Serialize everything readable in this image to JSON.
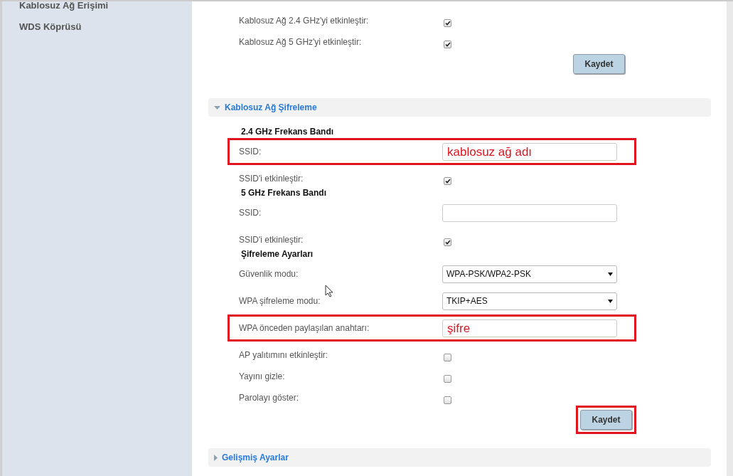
{
  "sidebar": {
    "items": [
      {
        "label": "Kablosuz Ağ Erişimi"
      },
      {
        "label": "WDS Köprüsü"
      }
    ]
  },
  "top_section": {
    "items": [
      {
        "kind": "checkbox",
        "label": "Kablosuz Ağ 2.4 GHz'yi etkinleştir:",
        "checked": true
      },
      {
        "kind": "checkbox",
        "label": "Kablosuz Ağ 5 GHz'yi etkinleştir:",
        "checked": true
      }
    ],
    "save_button": {
      "label": "Kaydet"
    }
  },
  "sections": [
    {
      "title": "Kablosuz Ağ Şifreleme",
      "expanded": true,
      "items": [
        {
          "kind": "heading",
          "label": "2.4 GHz Frekans Bandı"
        },
        {
          "kind": "text",
          "label": "SSID:",
          "value": "kablosuz ağ adı",
          "highlighted": true
        },
        {
          "kind": "checkbox",
          "label": "SSID'i etkinleştir:",
          "checked": true
        },
        {
          "kind": "heading",
          "label": "5 GHz Frekans Bandı"
        },
        {
          "kind": "text",
          "label": "SSID:"
        },
        {
          "kind": "checkbox",
          "label": "SSID'i etkinleştir:",
          "checked": true
        },
        {
          "kind": "heading",
          "label": "Şifreleme Ayarları"
        },
        {
          "kind": "select",
          "label": "Güvenlik modu:",
          "value": "WPA-PSK/WPA2-PSK"
        },
        {
          "kind": "select",
          "label": "WPA şifreleme modu:",
          "value": "TKIP+AES"
        },
        {
          "kind": "text",
          "label": "WPA önceden paylaşılan anahtarı:",
          "value": "şifre",
          "highlighted": true
        },
        {
          "kind": "checkbox",
          "label": "AP yalıtımını etkinleştir:",
          "checked": false
        },
        {
          "kind": "checkbox",
          "label": "Yayını gizle:",
          "checked": false
        },
        {
          "kind": "checkbox",
          "label": "Parolayı göster:",
          "checked": false
        }
      ],
      "save_button": {
        "label": "Kaydet",
        "highlighted": true
      }
    },
    {
      "title": "Gelişmiş Ayarlar",
      "expanded": false
    }
  ]
}
